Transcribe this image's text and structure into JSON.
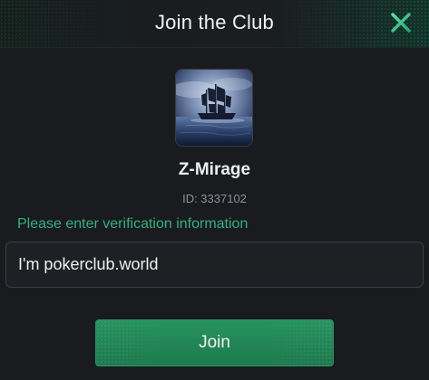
{
  "modal": {
    "title": "Join the Club",
    "close_icon": "close-x-icon",
    "accent_color": "#2fb37c"
  },
  "club": {
    "name": "Z-Mirage",
    "id_text": "ID: 3337102",
    "avatar_icon": "ghost-ship-image"
  },
  "form": {
    "prompt": "Please enter verification information",
    "input_value": "I'm pokerclub.world"
  },
  "actions": {
    "join_label": "Join"
  }
}
